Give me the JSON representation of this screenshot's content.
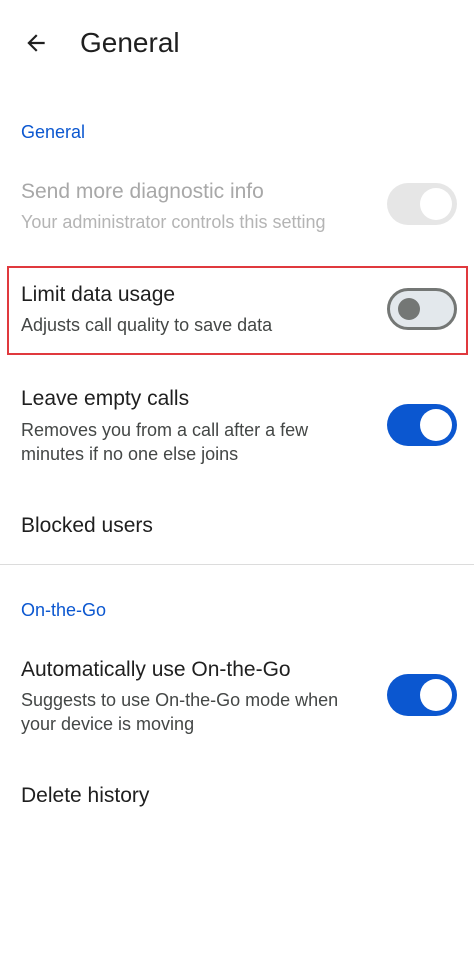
{
  "app_bar": {
    "title": "General",
    "back_icon": "arrow-back-icon"
  },
  "sections": {
    "general": {
      "header": "General",
      "diagnostic": {
        "title": "Send more diagnostic info",
        "subtitle": "Your administrator controls this setting",
        "enabled": false,
        "checked": true
      },
      "limit_data": {
        "title": "Limit data usage",
        "subtitle": "Adjusts call quality to save data",
        "checked": false
      },
      "leave_empty": {
        "title": "Leave empty calls",
        "subtitle": "Removes you from a call after a few minutes if no one else joins",
        "checked": true
      },
      "blocked_users": {
        "title": "Blocked users"
      }
    },
    "on_the_go": {
      "header": "On-the-Go",
      "auto_use": {
        "title": "Automatically use On-the-Go",
        "subtitle": "Suggests to use On-the-Go mode when your device is moving",
        "checked": true
      },
      "delete_history": {
        "title": "Delete history"
      }
    }
  },
  "colors": {
    "accent": "#0b57d0",
    "highlight": "#e0393e"
  }
}
